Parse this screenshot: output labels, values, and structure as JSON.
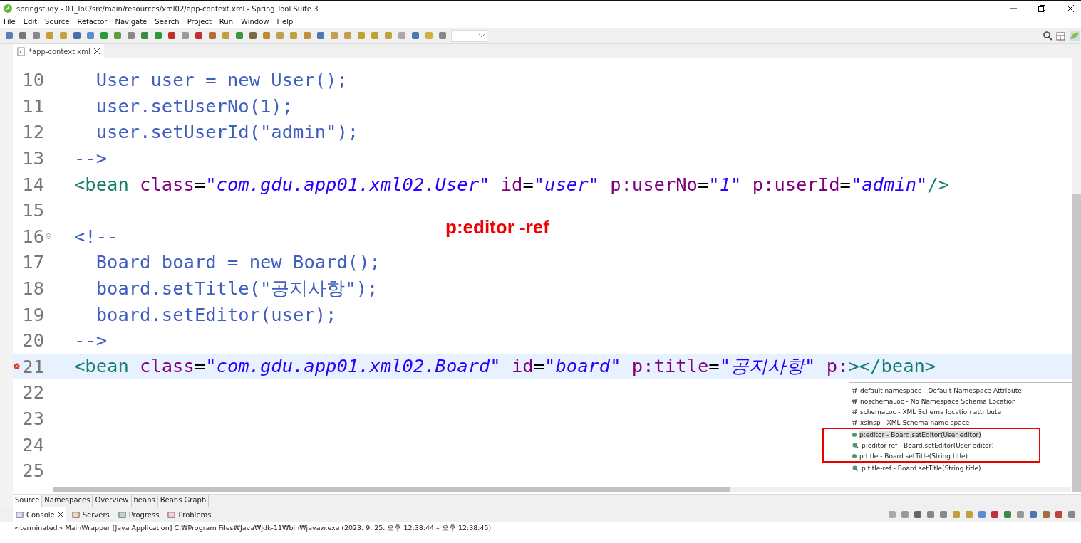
{
  "window": {
    "title": "springstudy - 01_IoC/src/main/resources/xml02/app-context.xml - Spring Tool Suite 3"
  },
  "menu": [
    "File",
    "Edit",
    "Source",
    "Refactor",
    "Navigate",
    "Search",
    "Project",
    "Run",
    "Window",
    "Help"
  ],
  "editor_tabs": [
    {
      "label": "*app-context.xml",
      "selected": true
    }
  ],
  "lines": [
    {
      "number": "10",
      "tokens": [
        {
          "kind": "comment",
          "text": "  User user = new User();"
        }
      ]
    },
    {
      "number": "11",
      "tokens": [
        {
          "kind": "comment",
          "text": "  user.setUserNo(1);"
        }
      ]
    },
    {
      "number": "12",
      "tokens": [
        {
          "kind": "comment",
          "text": "  user.setUserId(\"admin\");"
        }
      ]
    },
    {
      "number": "13",
      "tokens": [
        {
          "kind": "comment",
          "text": "-->"
        }
      ]
    },
    {
      "number": "14",
      "tokens": [
        {
          "kind": "tag",
          "text": "<bean"
        },
        {
          "kind": "attr",
          "text": "class"
        },
        {
          "kind": "plain",
          "text": "="
        },
        {
          "kind": "value",
          "text": "\"com.gdu.app01.xml02.User\""
        },
        {
          "kind": "attr",
          "text": "id"
        },
        {
          "kind": "plain",
          "text": "="
        },
        {
          "kind": "value",
          "text": "\"user\""
        },
        {
          "kind": "attr",
          "text": "p:userNo"
        },
        {
          "kind": "plain",
          "text": "="
        },
        {
          "kind": "value",
          "text": "\"1\""
        },
        {
          "kind": "attr",
          "text": "p:userId"
        },
        {
          "kind": "plain",
          "text": "="
        },
        {
          "kind": "value",
          "text": "\"admin\""
        },
        {
          "kind": "tag",
          "text": "/>"
        }
      ]
    },
    {
      "number": "15"
    },
    {
      "number": "16",
      "fold": true,
      "tokens": [
        {
          "kind": "comment",
          "text": "<!--"
        }
      ]
    },
    {
      "number": "17",
      "tokens": [
        {
          "kind": "comment",
          "text": "  Board board = new Board();"
        }
      ]
    },
    {
      "number": "18",
      "tokens": [
        {
          "kind": "comment",
          "text": "  board.setTitle(\"공지사항\");"
        }
      ]
    },
    {
      "number": "19",
      "tokens": [
        {
          "kind": "comment",
          "text": "  board.setEditor(user);"
        }
      ]
    },
    {
      "number": "20",
      "tokens": [
        {
          "kind": "comment",
          "text": "-->"
        }
      ]
    },
    {
      "number": "21",
      "current": true,
      "error": true,
      "tokens": [
        {
          "kind": "tag",
          "text": "<bean"
        },
        {
          "kind": "attr",
          "text": "class"
        },
        {
          "kind": "plain",
          "text": "="
        },
        {
          "kind": "value",
          "text": "\"com.gdu.app01.xml02.Board\""
        },
        {
          "kind": "attr",
          "text": "id"
        },
        {
          "kind": "plain",
          "text": "="
        },
        {
          "kind": "value",
          "text": "\"board\""
        },
        {
          "kind": "attr",
          "text": "p:title"
        },
        {
          "kind": "plain",
          "text": "="
        },
        {
          "kind": "value",
          "text": "\"공지사항\""
        },
        {
          "kind": "attr",
          "text": "p:"
        },
        {
          "kind": "tag",
          "text": "></bean>"
        }
      ]
    },
    {
      "number": "22"
    },
    {
      "number": "23"
    },
    {
      "number": "24"
    },
    {
      "number": "25"
    }
  ],
  "annotation": "p:editor -ref",
  "completion": [
    {
      "kind": "namespace",
      "text": "default namespace - Default Namespace Attribute",
      "selected": false,
      "marked": false
    },
    {
      "kind": "namespace",
      "text": "noschemaLoc - No Namespace Schema Location",
      "selected": false,
      "marked": false
    },
    {
      "kind": "namespace",
      "text": "schemaLoc - XML Schema location attribute",
      "selected": false,
      "marked": false
    },
    {
      "kind": "namespace",
      "text": "xsinsp - XML Schema name space",
      "selected": false,
      "marked": false
    },
    {
      "kind": "property",
      "text": "p:editor - Board.setEditor(User editor)",
      "selected": true,
      "marked": true
    },
    {
      "kind": "reference",
      "text": "p:editor-ref - Board.setEditor(User editor)",
      "selected": false,
      "marked": true
    },
    {
      "kind": "property",
      "text": "p:title - Board.setTitle(String title)",
      "selected": false,
      "marked": true
    },
    {
      "kind": "reference",
      "text": "p:title-ref - Board.setTitle(String title)",
      "selected": false,
      "marked": false
    }
  ],
  "page_tabs": [
    {
      "label": "Source",
      "selected": true
    },
    {
      "label": "Namespaces",
      "selected": false
    },
    {
      "label": "Overview",
      "selected": false
    },
    {
      "label": "beans",
      "selected": false
    },
    {
      "label": "Beans Graph",
      "selected": false
    }
  ],
  "console_tabs": [
    {
      "label": "Console",
      "selected": true
    },
    {
      "label": "Servers",
      "selected": false
    },
    {
      "label": "Progress",
      "selected": false
    },
    {
      "label": "Problems",
      "selected": false
    }
  ],
  "console_status": "<terminated> MainWrapper [Java Application] C:₩Program Files₩Java₩jdk-11₩bin₩javaw.exe  (2023. 9. 25. 오후 12:38:44 – 오후 12:38:45)"
}
